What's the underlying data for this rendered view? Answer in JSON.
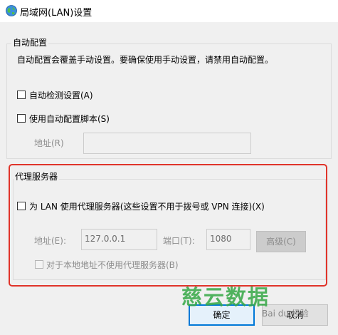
{
  "window": {
    "title": "局域网(LAN)设置"
  },
  "auto_config": {
    "group_label": "自动配置",
    "description": "自动配置会覆盖手动设置。要确保使用手动设置，请禁用自动配置。",
    "auto_detect_label": "自动检测设置(A)",
    "use_script_label": "使用自动配置脚本(S)",
    "address_label": "地址(R)",
    "address_value": ""
  },
  "proxy": {
    "group_label": "代理服务器",
    "use_proxy_label": "为 LAN 使用代理服务器(这些设置不用于拨号或 VPN 连接)(X)",
    "address_label": "地址(E):",
    "address_value": "127.0.0.1",
    "port_label": "端口(T):",
    "port_value": "1080",
    "advanced_label": "高级(C)",
    "bypass_local_label": "对于本地地址不使用代理服务器(B)"
  },
  "buttons": {
    "ok_label": "确定",
    "cancel_label": "取消"
  },
  "watermark": {
    "brand": "慈云数据",
    "sub": "Bai du 经验"
  },
  "colors": {
    "highlight": "#e0342a",
    "watermark": "#35a845",
    "primary_border": "#0078d7"
  }
}
